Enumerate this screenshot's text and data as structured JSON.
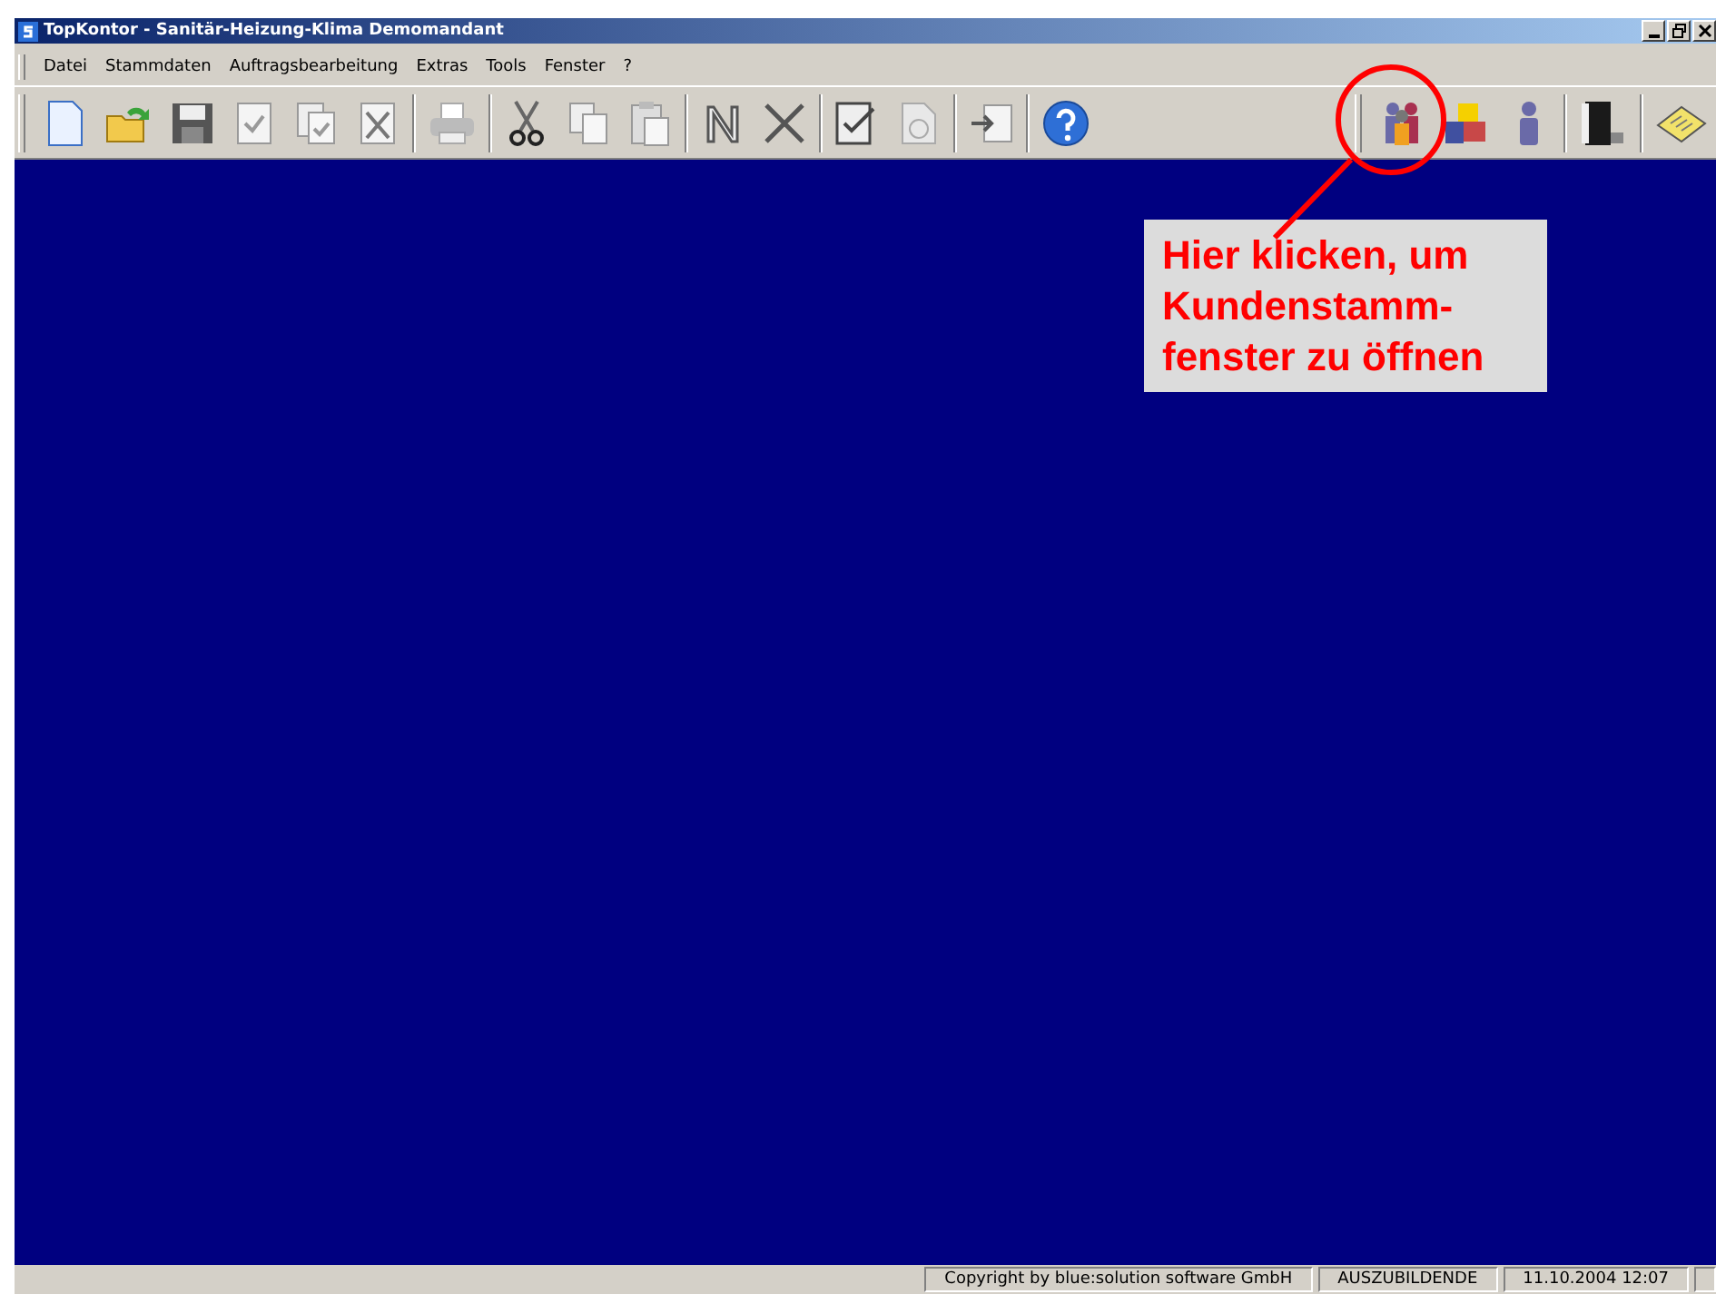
{
  "window": {
    "title": "TopKontor -  Sanitär-Heizung-Klima Demomandant"
  },
  "menu": [
    "Datei",
    "Stammdaten",
    "Auftragsbearbeitung",
    "Extras",
    "Tools",
    "Fenster",
    "?"
  ],
  "callout": {
    "text": "Hier klicken, um Kundenstamm-fenster zu öffnen"
  },
  "status_bar": [
    "Copyright by blue:solution software GmbH",
    "AUSZUBILDENDE",
    "11.10.2004 12:07"
  ]
}
